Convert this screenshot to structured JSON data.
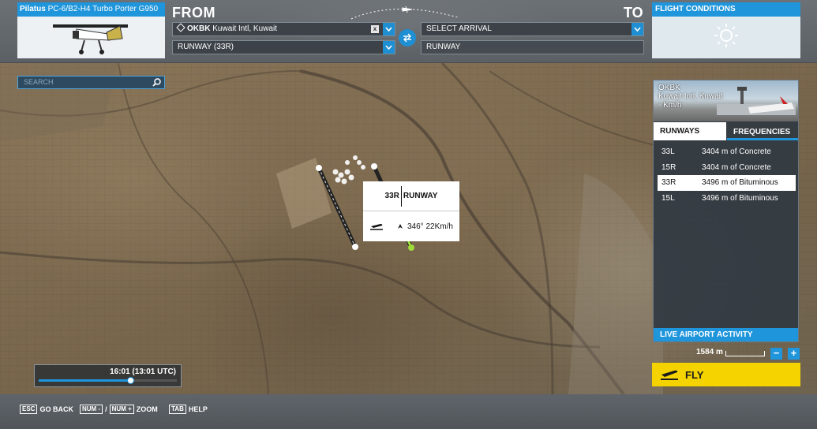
{
  "aircraft": {
    "brand": "Pilatus",
    "model": "PC-6/B2-H4 Turbo Porter G950"
  },
  "route": {
    "from_label": "FROM",
    "to_label": "TO",
    "departure_code": "OKBK",
    "departure_name": "Kuwait Intl, Kuwait",
    "clear_label": "x",
    "departure_runway": "RUNWAY (33R)",
    "arrival_placeholder": "SELECT ARRIVAL",
    "arrival_runway": "RUNWAY"
  },
  "conditions": {
    "title": "FLIGHT CONDITIONS",
    "weather_icon": "sun-icon"
  },
  "search": {
    "placeholder": "SEARCH"
  },
  "popup": {
    "runway_id": "33R",
    "runway_label": "RUNWAY",
    "wind": "346° 22Km/h"
  },
  "airport_panel": {
    "code": "OKBK",
    "name": "Kuwait Intl, Kuwait",
    "distance": "- Km/h",
    "tabs": [
      "RUNWAYS",
      "FREQUENCIES"
    ],
    "runways": [
      {
        "id": "33L",
        "desc": "3404 m of Concrete"
      },
      {
        "id": "15R",
        "desc": "3404 m of Concrete"
      },
      {
        "id": "33R",
        "desc": "3496 m of Bituminous"
      },
      {
        "id": "15L",
        "desc": "3496 m of Bituminous"
      }
    ],
    "selected_runway": "33R",
    "live_label": "LIVE AIRPORT ACTIVITY"
  },
  "map": {
    "scale_label": "1584 m",
    "zoom_out": "−",
    "zoom_in": "+"
  },
  "time": {
    "display": "16:01 (13:01 UTC)",
    "progress": 0.67
  },
  "fly_label": "FLY",
  "hints": {
    "back_key": "ESC",
    "back": "GO BACK",
    "zoom_key_minus": "NUM -",
    "zoom_sep": "/",
    "zoom_key_plus": "NUM +",
    "zoom": "ZOOM",
    "help_key": "TAB",
    "help": "HELP"
  },
  "colors": {
    "accent": "#1f95db",
    "fly": "#f5d300",
    "runway_marker": "#9fdc3a"
  }
}
